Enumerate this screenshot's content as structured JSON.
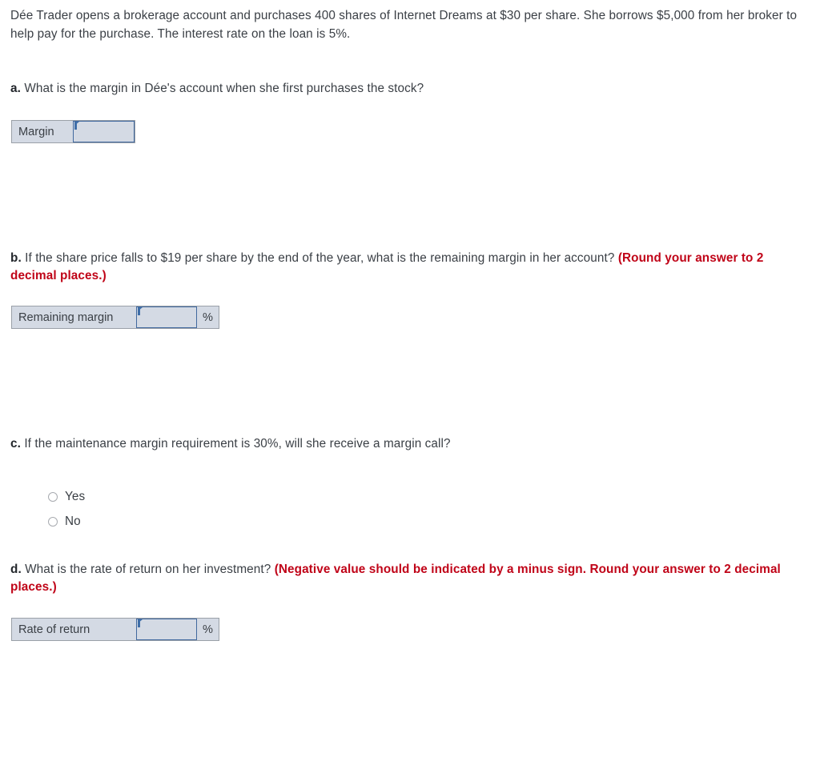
{
  "problem": {
    "intro": "Dée Trader opens a brokerage account and purchases 400 shares of Internet Dreams at $30 per share. She borrows $5,000 from her broker to help pay for the purchase. The interest rate on the loan is 5%."
  },
  "questions": {
    "a": {
      "letter": "a.",
      "text": " What is the margin in Dée's account when she first purchases the stock?",
      "note": "",
      "answer": {
        "label": "Margin",
        "value": "",
        "placeholder": "",
        "suffix": ""
      }
    },
    "b": {
      "letter": "b.",
      "text": " If the share price falls to $19 per share by the end of the year, what is the remaining margin in her account? ",
      "note": "(Round your answer to 2 decimal places.)",
      "answer": {
        "label": "Remaining margin",
        "value": "",
        "placeholder": "",
        "suffix": "%"
      }
    },
    "c": {
      "letter": "c.",
      "text": " If the maintenance margin requirement is 30%, will she receive a margin call?",
      "note": "",
      "options": [
        {
          "label": "Yes",
          "selected": false
        },
        {
          "label": "No",
          "selected": false
        }
      ]
    },
    "d": {
      "letter": "d.",
      "text": " What is the rate of return on her investment? ",
      "note": "(Negative value should be indicated by a minus sign. Round your answer to 2 decimal places.)",
      "answer": {
        "label": "Rate of return",
        "value": "",
        "placeholder": "",
        "suffix": "%"
      }
    }
  },
  "colors": {
    "text": "#3a3f45",
    "note_red": "#c00418",
    "field_border_blue": "#41699f",
    "field_fill": "#d4dae4",
    "cell_border": "#9aa0a8"
  }
}
